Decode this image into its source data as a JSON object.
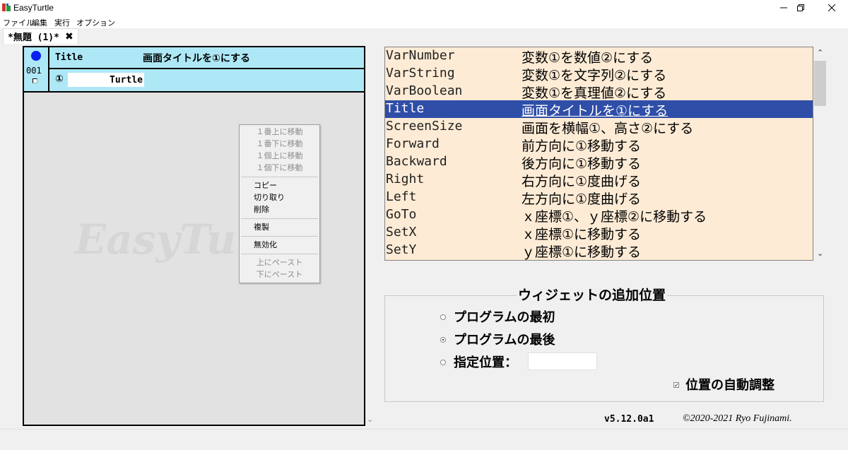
{
  "window": {
    "title": "EasyTurtle",
    "minimize_icon": "minimize-icon",
    "maximize_icon": "restore-icon",
    "close_icon": "close-icon"
  },
  "menu": [
    "ファイル",
    "編集",
    "実行",
    "オプション"
  ],
  "tab": {
    "label": "*無題 (1)*",
    "close_glyph": "✖"
  },
  "program": {
    "watermark": "EasyTurtle",
    "block": {
      "id": "001",
      "command": "Title",
      "description": "画面タイトルを①にする",
      "arg_label": "①",
      "arg_value": "Turtle",
      "dot_color": "#0a1ff0",
      "bg_color": "#aee8f6"
    }
  },
  "context_menu": {
    "group1": [
      "１番上に移動",
      "１番下に移動",
      "１個上に移動",
      "１個下に移動"
    ],
    "group2": [
      "コピー",
      "切り取り",
      "削除"
    ],
    "group3": [
      "複製"
    ],
    "group4": [
      "無効化"
    ],
    "group5": [
      "上にペースト",
      "下にペースト"
    ]
  },
  "commands": [
    {
      "name": "VarNumber",
      "desc": "変数①を数値②にする"
    },
    {
      "name": "VarString",
      "desc": "変数①を文字列②にする"
    },
    {
      "name": "VarBoolean",
      "desc": "変数①を真理値②にする"
    },
    {
      "name": "Title",
      "desc": "画面タイトルを①にする",
      "selected": true
    },
    {
      "name": "ScreenSize",
      "desc": "画面を横幅①、高さ②にする"
    },
    {
      "name": "Forward",
      "desc": "前方向に①移動する"
    },
    {
      "name": "Backward",
      "desc": "後方向に①移動する"
    },
    {
      "name": "Right",
      "desc": "右方向に①度曲げる"
    },
    {
      "name": "Left",
      "desc": "左方向に①度曲げる"
    },
    {
      "name": "GoTo",
      "desc": "ｘ座標①、ｙ座標②に移動する"
    },
    {
      "name": "SetX",
      "desc": "ｘ座標①に移動する"
    },
    {
      "name": "SetY",
      "desc": "ｙ座標①に移動する"
    }
  ],
  "widget_position": {
    "title": "ウィジェットの追加位置",
    "options": [
      {
        "label": "プログラムの最初",
        "checked": false
      },
      {
        "label": "プログラムの最後",
        "checked": true
      },
      {
        "label": "指定位置：",
        "checked": false
      }
    ],
    "specified_value": "",
    "auto_adjust_label": "位置の自動調整",
    "auto_adjust_checked": true
  },
  "footer": {
    "version": "v5.12.0a1",
    "copyright": "©2020-2021 Ryo Fujinami."
  },
  "colors": {
    "selected_row": "#2f4ea8",
    "list_bg": "#fdebd5",
    "block_bg": "#aee8f6"
  }
}
